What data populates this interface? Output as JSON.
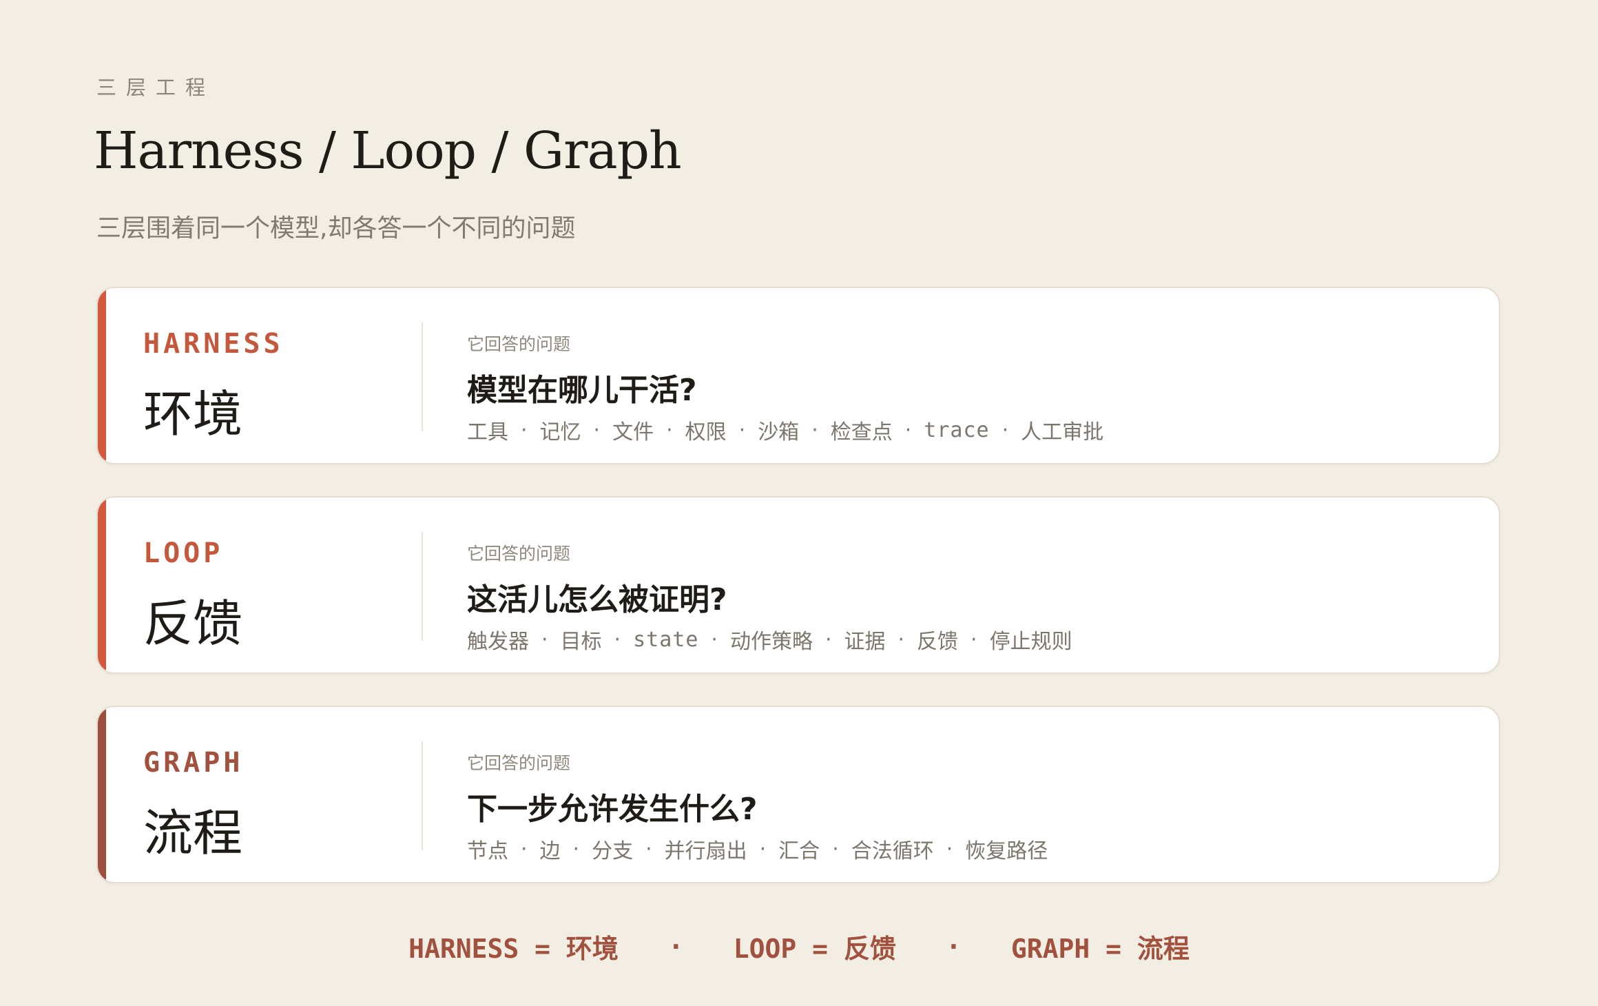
{
  "header": {
    "eyebrow": "三层工程",
    "title": "Harness / Loop / Graph",
    "subtitle": "三层围着同一个模型,却各答一个不同的问题"
  },
  "colors": {
    "background": "#f3eee3",
    "harness_accent": "#d2593d",
    "loop_accent": "#d2593d",
    "graph_accent": "#9e4e3d",
    "footer": "#a1513e"
  },
  "cards": [
    {
      "tag": "HARNESS",
      "name_cn": "环境",
      "question_label": "它回答的问题",
      "question": "模型在哪儿干活?",
      "items": [
        "工具",
        "记忆",
        "文件",
        "权限",
        "沙箱",
        "检查点",
        "trace",
        "人工审批"
      ]
    },
    {
      "tag": "LOOP",
      "name_cn": "反馈",
      "question_label": "它回答的问题",
      "question": "这活儿怎么被证明?",
      "items": [
        "触发器",
        "目标",
        "state",
        "动作策略",
        "证据",
        "反馈",
        "停止规则"
      ]
    },
    {
      "tag": "GRAPH",
      "name_cn": "流程",
      "question_label": "它回答的问题",
      "question": "下一步允许发生什么?",
      "items": [
        "节点",
        "边",
        "分支",
        "并行扇出",
        "汇合",
        "合法循环",
        "恢复路径"
      ]
    }
  ],
  "footer": {
    "items": [
      "HARNESS = 环境",
      "LOOP = 反馈",
      "GRAPH = 流程"
    ],
    "separator": "·"
  }
}
